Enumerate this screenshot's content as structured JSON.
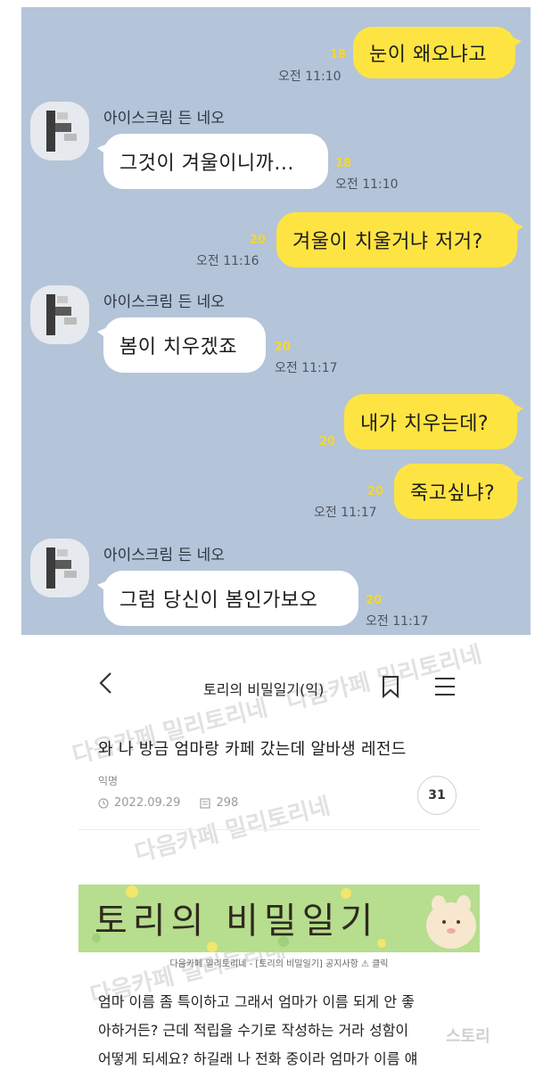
{
  "chat": {
    "messages": [
      {
        "side": "mine",
        "text": "눈이 왜오냐고",
        "read": "18",
        "time": "오전 11:10"
      },
      {
        "side": "theirs",
        "sender": "아이스크림 든 네오",
        "text": "그것이 겨울이니까...",
        "read": "18",
        "time": "오전 11:10"
      },
      {
        "side": "mine",
        "text": "겨울이 치울거냐 저거?",
        "read": "20",
        "time": "오전 11:16"
      },
      {
        "side": "theirs",
        "sender": "아이스크림 든 네오",
        "text": "봄이 치우겠죠",
        "read": "20",
        "time": "오전 11:17"
      },
      {
        "side": "mine",
        "text": "내가 치우는데?",
        "read": "20",
        "time": ""
      },
      {
        "side": "mine",
        "text": "죽고싶냐?",
        "read": "20",
        "time": "오전 11:17"
      },
      {
        "side": "theirs",
        "sender": "아이스크림 든 네오",
        "text": "그럼 당신이 봄인가보오",
        "read": "20",
        "time": "오전 11:17"
      }
    ],
    "colors": {
      "background": "#b4c4d9",
      "my_bubble": "#fee443",
      "their_bubble": "#ffffff",
      "read_count": "#f4d72e"
    }
  },
  "cafe": {
    "header": {
      "title": "토리의 비밀일기(익)",
      "back_icon": "chevron-left-icon",
      "bookmark_icon": "bookmark-icon",
      "menu_icon": "menu-icon"
    },
    "post": {
      "title": "와 나 방금 엄마랑 카페 갔는데 알바생 레전드",
      "author": "익명",
      "date": "2022.09.29",
      "views": "298",
      "comments": "31"
    },
    "banner": {
      "title": "토리의 비밀일기",
      "caption": "다음카페 밀리토리네 - [토리의 비밀일기] 공지사항 ⚠ 클릭"
    },
    "body": [
      "엄마 이름 좀 특이하고 그래서 엄마가 이름 되게 안 좋",
      "아하거든? 근데 적립을 수기로 작성하는 거라 성함이",
      "어떻게 되세요? 하길래 나 전화 중이라 엄마가 이름 얘"
    ],
    "watermarks": [
      "다음카페 밀리토리네",
      "다음카페 밀리토리네",
      "다음카페 밀리토리네",
      "다음카페 밀리토리네",
      "스토리"
    ]
  }
}
